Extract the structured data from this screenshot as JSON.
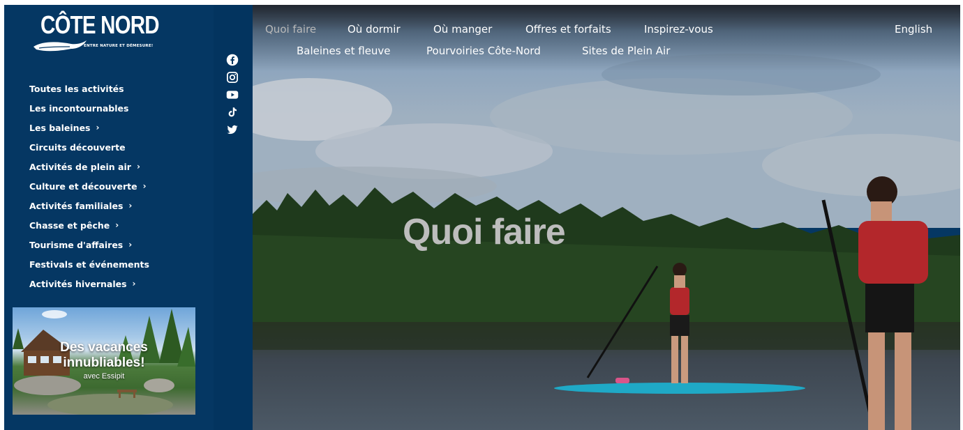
{
  "brand": {
    "name": "CÔTE NORD",
    "tagline": "ENTRE NATURE ET DÉMESURE!"
  },
  "sidebar": {
    "items": [
      {
        "label": "Toutes les activités",
        "chevron": false
      },
      {
        "label": "Les incontournables",
        "chevron": false
      },
      {
        "label": "Les baleines",
        "chevron": true
      },
      {
        "label": "Circuits découverte",
        "chevron": false
      },
      {
        "label": "Activités de plein air",
        "chevron": true
      },
      {
        "label": "Culture et découverte",
        "chevron": true
      },
      {
        "label": "Activités familiales",
        "chevron": true
      },
      {
        "label": "Chasse et pêche",
        "chevron": true
      },
      {
        "label": "Tourisme d'affaires",
        "chevron": true
      },
      {
        "label": "Festivals et événements",
        "chevron": false
      },
      {
        "label": "Activités hivernales",
        "chevron": true
      }
    ],
    "chevron_glyph": "›"
  },
  "promo": {
    "line1": "Des vacances",
    "line2": "innubliables!",
    "sub": "avec Essipit"
  },
  "social": [
    "facebook-icon",
    "instagram-icon",
    "youtube-icon",
    "tiktok-icon",
    "twitter-icon"
  ],
  "nav": {
    "quoi_faire": "Quoi faire",
    "ou_dormir": "Où dormir",
    "ou_manger": "Où manger",
    "offres": "Offres et forfaits",
    "inspirez": "Inspirez-vous",
    "english": "English",
    "baleines": "Baleines et fleuve",
    "pourvoiries": "Pourvoiries Côte-Nord",
    "sites": "Sites de Plein Air"
  },
  "hero": {
    "title": "Quoi faire"
  },
  "colors": {
    "sidebar_bg": "#053763",
    "active_nav": "#b9b9b9",
    "paddleboard": "#1fa9c6"
  }
}
